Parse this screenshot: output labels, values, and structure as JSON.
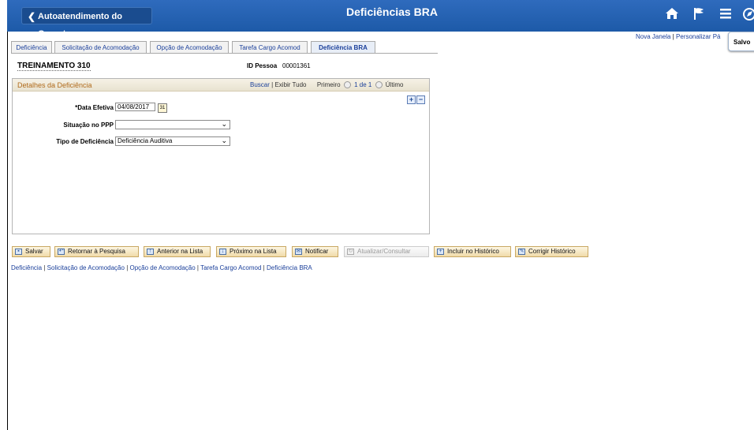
{
  "header": {
    "back_label": "Autoatendimento do Gerente",
    "title": "Deficiências BRA",
    "icons": [
      "home-icon",
      "flag-icon",
      "menu-icon",
      "navbar-icon"
    ]
  },
  "top_links": {
    "new_window": "Nova Janela",
    "separator": "|",
    "personalize": "Personalizar Pá"
  },
  "toast": {
    "label": "Salvo"
  },
  "tabs": [
    {
      "label": "Deficiência",
      "active": false
    },
    {
      "label": "Solicitação de Acomodação",
      "active": false
    },
    {
      "label": "Opção de Acomodação",
      "active": false
    },
    {
      "label": "Tarefa Cargo Acomod",
      "active": false
    },
    {
      "label": "Deficiência BRA",
      "active": true
    }
  ],
  "employee": {
    "name": "TREINAMENTO 310",
    "id_label": "ID Pessoa",
    "id_value": "00001361"
  },
  "panel": {
    "title": "Detalhes da Deficiência",
    "search": "Buscar",
    "separator": "|",
    "view_all": "Exibir Tudo",
    "first": "Primeiro",
    "count": "1 de 1",
    "last": "Último",
    "add": "+",
    "remove": "−"
  },
  "form": {
    "effective_date_label": "*Data Efetiva",
    "effective_date_value": "04/08/2017",
    "calendar_glyph": "31",
    "ppp_label": "Situação no PPP",
    "ppp_value": "",
    "type_label": "Tipo de Deficiência",
    "type_value": "Deficiência Auditiva",
    "dropdown_glyph": "⌄"
  },
  "buttons": [
    {
      "label": "Salvar",
      "enabled": true,
      "icon": "save-icon"
    },
    {
      "label": "Retornar à Pesquisa",
      "enabled": true,
      "icon": "return-icon"
    },
    {
      "label": "Anterior na Lista",
      "enabled": true,
      "icon": "previous-icon"
    },
    {
      "label": "Próximo na Lista",
      "enabled": true,
      "icon": "next-icon"
    },
    {
      "label": "Notificar",
      "enabled": true,
      "icon": "notify-icon"
    },
    {
      "label": "Atualizar/Consultar",
      "enabled": false,
      "icon": "refresh-icon"
    },
    {
      "label": "Incluir no Histórico",
      "enabled": true,
      "icon": "add-history-icon"
    },
    {
      "label": "Corrigir Histórico",
      "enabled": true,
      "icon": "correct-history-icon"
    }
  ],
  "bottom_links": [
    "Deficiência",
    "Solicitação de Acomodação",
    "Opção de Acomodação",
    "Tarefa Cargo Acomod",
    "Deficiência BRA"
  ],
  "link_separator": " | "
}
